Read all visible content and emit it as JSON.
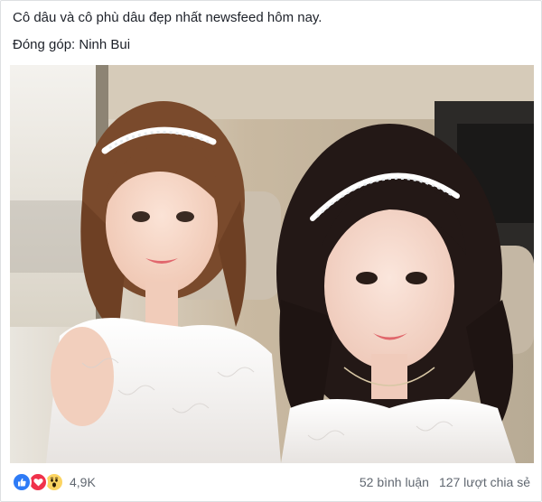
{
  "post": {
    "caption": "Cô dâu và cô phù dâu đẹp nhất newsfeed hôm nay.",
    "credit": "Đóng góp: Ninh Bui"
  },
  "photo": {
    "subject": "selfie of bride and bridesmaid in a car"
  },
  "footer": {
    "reactions": [
      "like-icon",
      "love-icon",
      "wow-icon"
    ],
    "reaction_count": "4,9K",
    "comments": "52 bình luận",
    "shares": "127 lượt chia sẻ"
  },
  "colors": {
    "like": "#2e7bf6",
    "love": "#f0324b",
    "wow": "#fcd461",
    "meta_text": "#606770"
  }
}
